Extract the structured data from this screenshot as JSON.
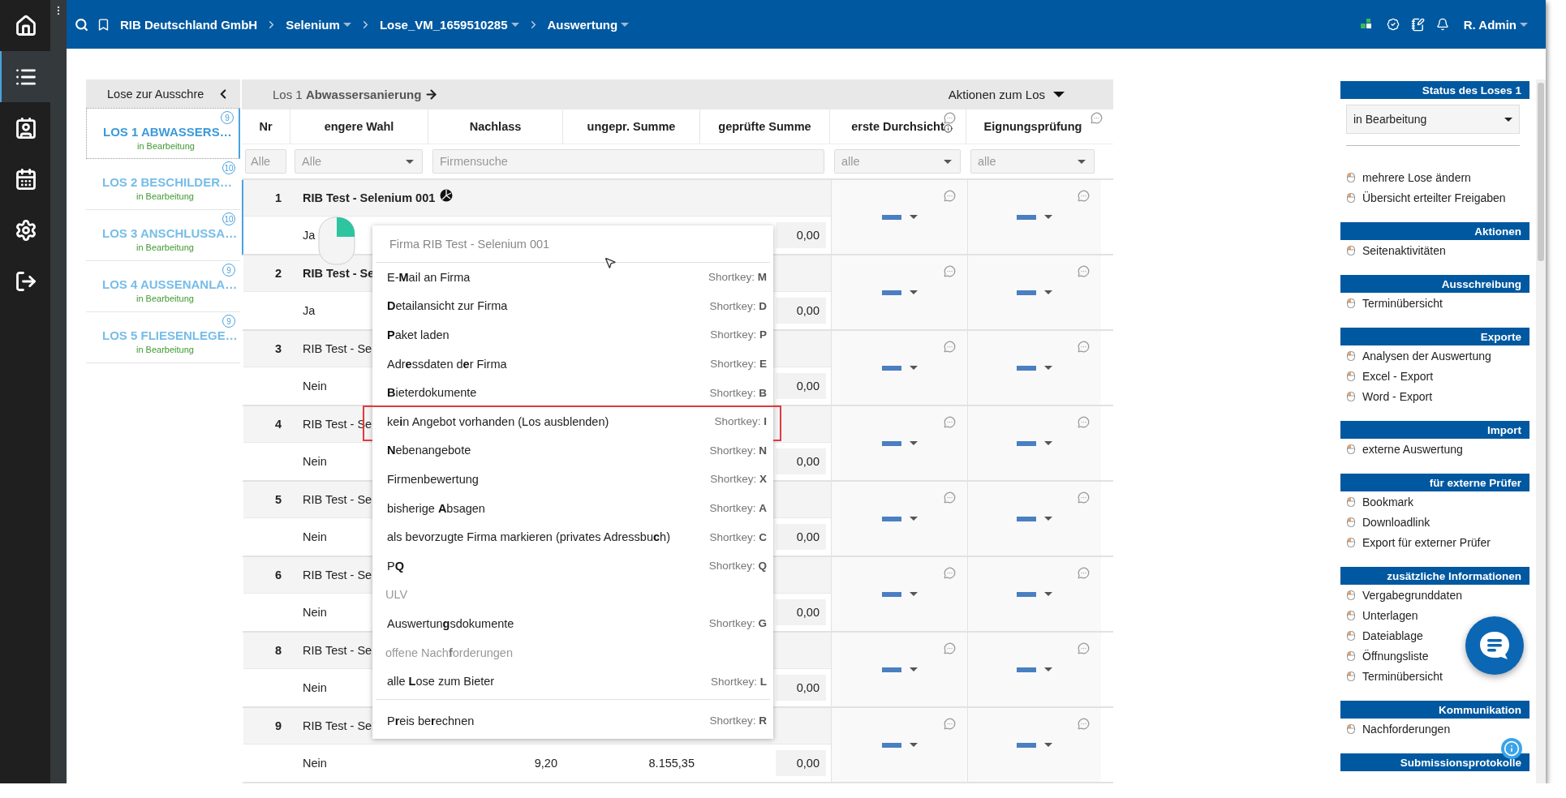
{
  "sidebar": {
    "items": [
      {
        "selected": false
      },
      {
        "selected": true
      },
      {
        "selected": false
      },
      {
        "selected": false
      },
      {
        "selected": false
      },
      {
        "selected": false
      }
    ]
  },
  "topbar": {
    "breadcrumbs": [
      {
        "label": "RIB Deutschland GmbH",
        "dropdown": false
      },
      {
        "label": "Selenium",
        "dropdown": true
      },
      {
        "label": "Lose_VM_1659510285",
        "dropdown": true
      },
      {
        "label": "Auswertung",
        "dropdown": true
      }
    ],
    "user": "R. Admin"
  },
  "lots_panel": {
    "title": "Lose zur Ausschre",
    "lots": [
      {
        "label": "LOS 1 ABWASSERS…",
        "status": "in Bearbeitung",
        "count": "9",
        "selected": true
      },
      {
        "label": "LOS 2 BESCHILDER…",
        "status": "in Bearbeitung",
        "count": "10",
        "selected": false
      },
      {
        "label": "LOS 3 ANSCHLUSSA…",
        "status": "in Bearbeitung",
        "count": "10",
        "selected": false
      },
      {
        "label": "LOS 4 AUSSENANLA…",
        "status": "in Bearbeitung",
        "count": "9",
        "selected": false
      },
      {
        "label": "LOS 5 FLIESENLEGE…",
        "status": "in Bearbeitung",
        "count": "9",
        "selected": false
      }
    ]
  },
  "table": {
    "lot_title": "Los 1 **Abwassersanierung**",
    "actions": "Aktionen zum Los",
    "columns": [
      "Nr",
      "engere Wahl",
      "Nachlass",
      "ungepr. Summe",
      "geprüfte Summe",
      "erste Durchsicht",
      "Eignungsprüfung"
    ],
    "filters": {
      "nr": "Alle",
      "engere_wahl": "Alle",
      "search_placeholder": "Firmensuche",
      "erste_durchsicht": "alle",
      "eignungspruefung": "alle"
    },
    "rows": [
      {
        "nr": "1",
        "name": "RIB Test - Selenium 001",
        "bold": true,
        "selected": true,
        "has_icon": true,
        "choice": "Ja",
        "value": "0,00"
      },
      {
        "nr": "2",
        "name": "RIB Test - Se",
        "bold": true,
        "selected": false,
        "has_icon": false,
        "choice": "Ja",
        "value": "0,00"
      },
      {
        "nr": "3",
        "name": "RIB Test - Se",
        "bold": false,
        "selected": false,
        "has_icon": false,
        "choice": "Nein",
        "value": "0,00"
      },
      {
        "nr": "4",
        "name": "RIB Test - Se",
        "bold": false,
        "selected": false,
        "has_icon": false,
        "choice": "Nein",
        "value": "0,00"
      },
      {
        "nr": "5",
        "name": "RIB Test - Se",
        "bold": false,
        "selected": false,
        "has_icon": false,
        "choice": "Nein",
        "value": "0,00"
      },
      {
        "nr": "6",
        "name": "RIB Test - Se",
        "bold": false,
        "selected": false,
        "has_icon": false,
        "choice": "Nein",
        "value": "0,00"
      },
      {
        "nr": "8",
        "name": "RIB Test - Se",
        "bold": false,
        "selected": false,
        "has_icon": false,
        "choice": "Nein",
        "value": "0,00"
      },
      {
        "nr": "9",
        "name": "RIB Test - Se",
        "bold": false,
        "selected": false,
        "has_icon": false,
        "choice": "Nein",
        "nachlass": "9,20",
        "ungepr": "8.155,35",
        "value": "0,00"
      }
    ]
  },
  "context_menu": {
    "header": "Firma RIB Test - Selenium 001",
    "groups": [
      [
        {
          "label": "E-**M**ail an Firma",
          "shortcut": "Shortkey: **M**",
          "disabled": false,
          "highlighted": false
        },
        {
          "label": "**D**etailansicht zur Firma",
          "shortcut": "Shortkey: **D**",
          "disabled": false,
          "highlighted": false
        },
        {
          "label": "**P**aket laden",
          "shortcut": "Shortkey: **P**",
          "disabled": false,
          "highlighted": false
        },
        {
          "label": "Adr**e**ssdaten d**e**r Firma",
          "shortcut": "Shortkey: **E**",
          "disabled": false,
          "highlighted": false
        },
        {
          "label": "**B**ieterdokumente",
          "shortcut": "Shortkey: **B**",
          "disabled": false,
          "highlighted": false
        },
        {
          "label": "ke**i**n Angebot vorhanden (Los ausblenden)",
          "shortcut": "Shortkey: **I**",
          "disabled": false,
          "highlighted": true
        },
        {
          "label": "**N**ebenangebote",
          "shortcut": "Shortkey: **N**",
          "disabled": false,
          "highlighted": false
        },
        {
          "label": "Firmenbewertung",
          "shortcut": "Shortkey: **X**",
          "disabled": false,
          "highlighted": false
        },
        {
          "label": "bisherige **A**bsagen",
          "shortcut": "Shortkey: **A**",
          "disabled": false,
          "highlighted": false
        },
        {
          "label": "als bevorzugte Firma markieren (privates Adressbu**c**h)",
          "shortcut": "Shortkey: **C**",
          "disabled": false,
          "highlighted": false
        },
        {
          "label": "P**Q**",
          "shortcut": "Shortkey: **Q**",
          "disabled": false,
          "highlighted": false
        },
        {
          "label": "ULV",
          "disabled": true,
          "highlighted": false
        },
        {
          "label": "Auswertun**g**sdokumente",
          "shortcut": "Shortkey: **G**",
          "disabled": false,
          "highlighted": false
        },
        {
          "label": "offene Nach**f**orderungen",
          "disabled": true,
          "highlighted": false
        },
        {
          "label": "alle **L**ose zum Bieter",
          "shortcut": "Shortkey: **L**",
          "disabled": false,
          "highlighted": false
        }
      ],
      [
        {
          "label": "P**r**eis be**r**echnen",
          "shortcut": "Shortkey: **R**",
          "disabled": false,
          "highlighted": false
        }
      ]
    ]
  },
  "right_panel": {
    "sections": [
      {
        "title": "Status des Loses 1",
        "select": "in Bearbeitung",
        "items": [
          "mehrere Lose ändern",
          "Übersicht erteilter Freigaben"
        ]
      },
      {
        "title": "Aktionen",
        "items": [
          "Seitenaktivitäten"
        ]
      },
      {
        "title": "Ausschreibung",
        "items": [
          "Terminübersicht"
        ]
      },
      {
        "title": "Exporte",
        "items": [
          "Analysen der Auswertung",
          "Excel - Export",
          "Word - Export"
        ]
      },
      {
        "title": "Import",
        "items": [
          "externe Auswertung"
        ]
      },
      {
        "title": "für externe Prüfer",
        "items": [
          "Bookmark",
          "Downloadlink",
          "Export für externer Prüfer"
        ]
      },
      {
        "title": "zusätzliche Informationen",
        "items": [
          "Vergabegrunddaten",
          "Unterlagen",
          "Dateiablage",
          "Öffnungsliste",
          "Terminübersicht"
        ]
      },
      {
        "title": "Kommunikation",
        "items": [
          "Nachforderungen"
        ]
      },
      {
        "title": "Submissionsprotokolle"
      }
    ]
  }
}
